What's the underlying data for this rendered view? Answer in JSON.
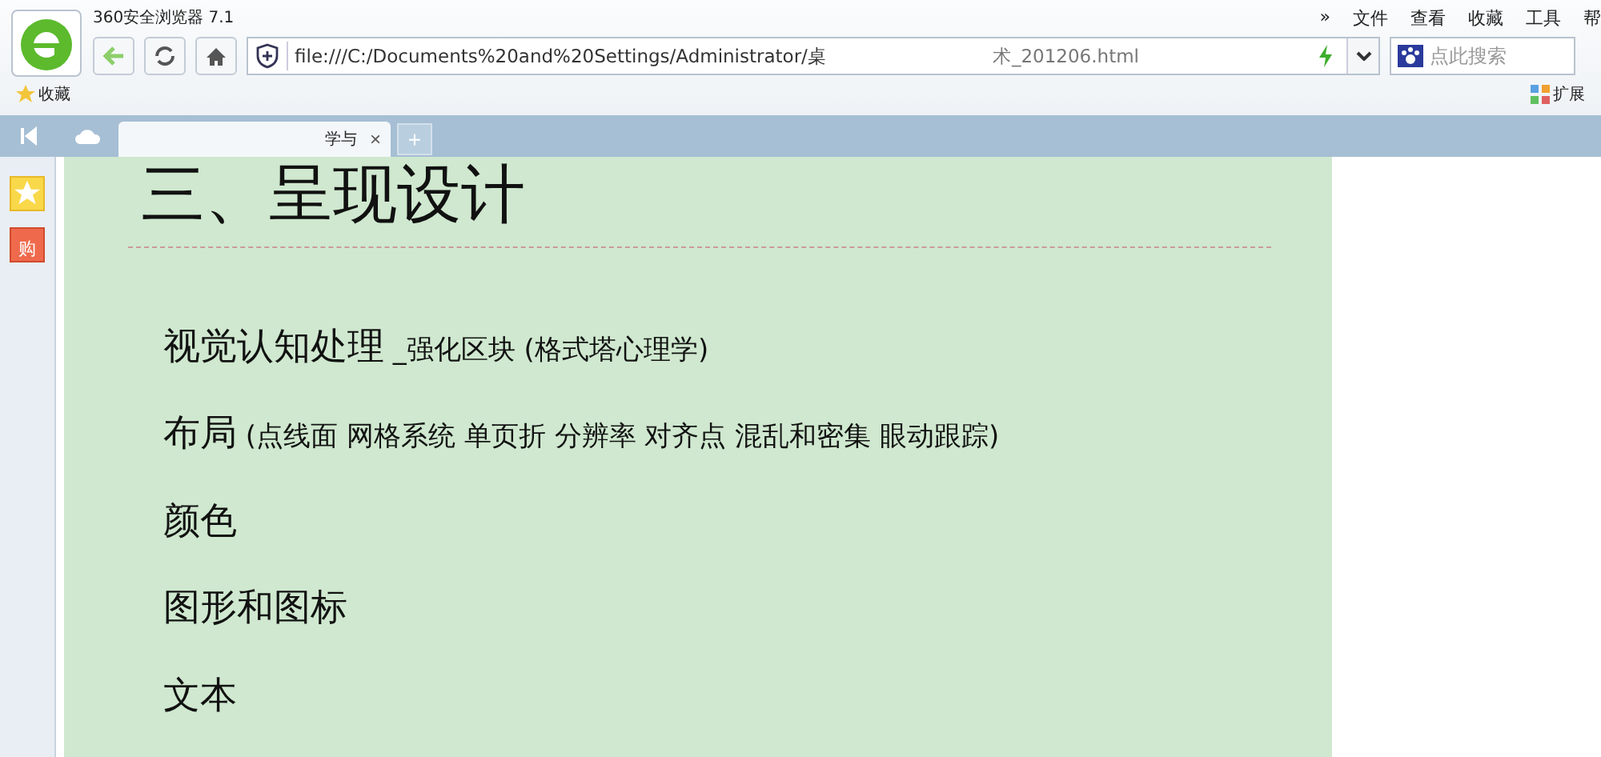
{
  "window": {
    "title": "360安全浏览器 7.1"
  },
  "menu": [
    {
      "label": "»"
    },
    {
      "label": "文件"
    },
    {
      "label": "查看"
    },
    {
      "label": "收藏"
    },
    {
      "label": "工具"
    },
    {
      "label": "帮"
    }
  ],
  "address": {
    "value_start": "file:///C:/Documents%20and%20Settings/Administrator/桌",
    "value_end": "术_201206.html"
  },
  "search": {
    "placeholder": "点此搜索"
  },
  "bookmarks": {
    "label": "收藏"
  },
  "extensions": {
    "label": "扩展"
  },
  "tabs": [
    {
      "label": "学与",
      "selected": true,
      "close": "×"
    }
  ],
  "new_tab": "+",
  "sidebar": [
    {
      "kind": "favorite"
    },
    {
      "kind": "shop",
      "label": "购"
    }
  ],
  "page": {
    "heading": "三、呈现设计",
    "items": [
      {
        "title": "视觉认知处理",
        "note": "_强化区块 (格式塔心理学)"
      },
      {
        "title": "布局",
        "note": "(点线面 网格系统 单页折 分辨率 对齐点 混乱和密集 眼动跟踪)"
      },
      {
        "title": "颜色"
      },
      {
        "title": "图形和图标"
      },
      {
        "title": "文本"
      }
    ]
  }
}
